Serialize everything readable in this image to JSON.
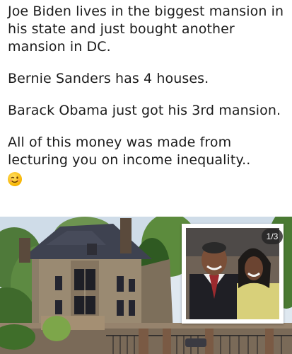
{
  "post": {
    "paragraph_1": "Joe Biden lives in the biggest mansion in his state and just bought another mansion in DC.",
    "paragraph_2": "Bernie Sanders has 4 houses.",
    "paragraph_3": "Barack Obama just got his 3rd mansion.",
    "paragraph_4": "All of this money was made from lecturing you on income inequality..",
    "emoji": "winking-face-icon"
  },
  "media": {
    "counter": "1/3"
  }
}
